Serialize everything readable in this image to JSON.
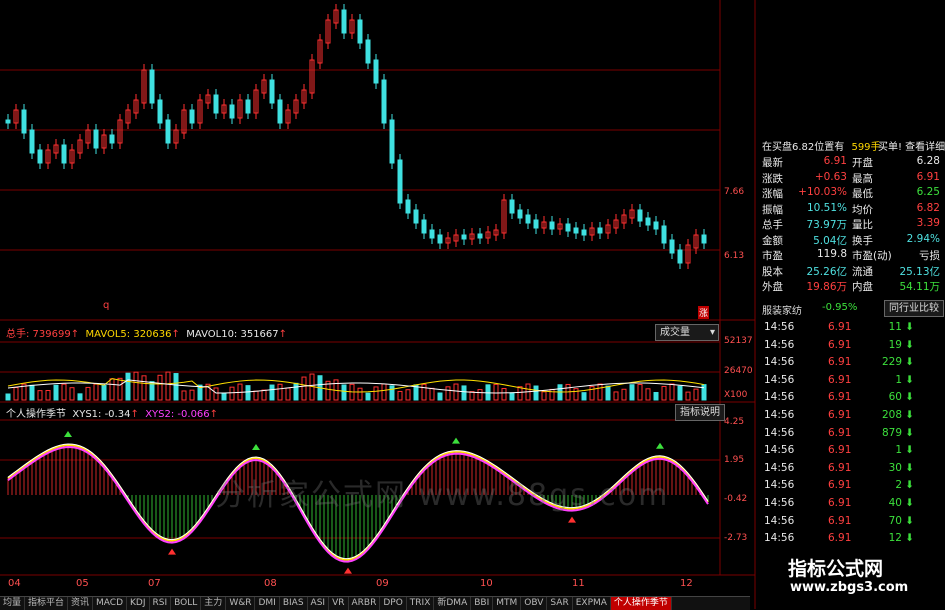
{
  "price_axis": {
    "ticks": [
      "7.66",
      "6.13"
    ]
  },
  "marker_labels": {
    "left_top": "q",
    "right_mark": "涨"
  },
  "volume_header": {
    "total": "总手: 739699",
    "mavol5": "MAVOL5: 320636",
    "mavol10": "MAVOL10: 351667"
  },
  "volume_axis": {
    "ticks": [
      "52137",
      "26470",
      "X100"
    ]
  },
  "volume_button": "成交量",
  "indicator_header": {
    "name": "个人操作季节",
    "xys1": "XYS1: -0.34",
    "xys2": "XYS2: -0.066"
  },
  "indicator_button": "指标说明",
  "indicator_axis": {
    "ticks": [
      "4.25",
      "1.95",
      "-0.42",
      "-2.73"
    ]
  },
  "date_axis": [
    "04",
    "05",
    "07",
    "08",
    "09",
    "10",
    "11",
    "12"
  ],
  "tabs": [
    "均量",
    "指标平台",
    "资讯",
    "MACD",
    "KDJ",
    "RSI",
    "BOLL",
    "主力",
    "W&R",
    "DMI",
    "BIAS",
    "ASI",
    "VR",
    "ARBR",
    "DPO",
    "TRIX",
    "新DMA",
    "BBI",
    "MTM",
    "OBV",
    "SAR",
    "EXPMA",
    "个人操作季节"
  ],
  "active_tab": "个人操作季节",
  "order_header": {
    "text": "在买盘6.82位置有",
    "qty": "599手",
    "link": "买单! 查看详细"
  },
  "quote": [
    {
      "l1": "最新",
      "v1": "6.91",
      "c1": "red",
      "l2": "开盘",
      "v2": "6.28",
      "c2": "white"
    },
    {
      "l1": "涨跌",
      "v1": "+0.63",
      "c1": "red",
      "l2": "最高",
      "v2": "6.91",
      "c2": "red"
    },
    {
      "l1": "涨幅",
      "v1": "+10.03%",
      "c1": "red",
      "l2": "最低",
      "v2": "6.25",
      "c2": "green"
    },
    {
      "l1": "振幅",
      "v1": "10.51%",
      "c1": "cyan",
      "l2": "均价",
      "v2": "6.82",
      "c2": "red"
    },
    {
      "l1": "总手",
      "v1": "73.97万",
      "c1": "cyan",
      "l2": "量比",
      "v2": "3.39",
      "c2": "red"
    },
    {
      "l1": "金额",
      "v1": "5.04亿",
      "c1": "cyan",
      "l2": "换手",
      "v2": "2.94%",
      "c2": "cyan"
    },
    {
      "l1": "市盈",
      "v1": "119.8",
      "c1": "white",
      "l2": "市盈(动)",
      "v2": "亏损",
      "c2": "white"
    },
    {
      "l1": "股本",
      "v1": "25.26亿",
      "c1": "cyan",
      "l2": "流通",
      "v2": "25.13亿",
      "c2": "cyan"
    },
    {
      "l1": "外盘",
      "v1": "19.86万",
      "c1": "red",
      "l2": "内盘",
      "v2": "54.11万",
      "c2": "green"
    }
  ],
  "sector": {
    "name": "服装家纺",
    "change": "-0.95%",
    "button": "同行业比较"
  },
  "trades": [
    {
      "time": "14:56",
      "price": "6.91",
      "qty": "11",
      "dir": "down"
    },
    {
      "time": "14:56",
      "price": "6.91",
      "qty": "19",
      "dir": "down"
    },
    {
      "time": "14:56",
      "price": "6.91",
      "qty": "229",
      "dir": "down"
    },
    {
      "time": "14:56",
      "price": "6.91",
      "qty": "1",
      "dir": "down"
    },
    {
      "time": "14:56",
      "price": "6.91",
      "qty": "60",
      "dir": "down"
    },
    {
      "time": "14:56",
      "price": "6.91",
      "qty": "208",
      "dir": "down"
    },
    {
      "time": "14:56",
      "price": "6.91",
      "qty": "879",
      "dir": "down"
    },
    {
      "time": "14:56",
      "price": "6.91",
      "qty": "1",
      "dir": "down"
    },
    {
      "time": "14:56",
      "price": "6.91",
      "qty": "30",
      "dir": "down"
    },
    {
      "time": "14:56",
      "price": "6.91",
      "qty": "2",
      "dir": "down"
    },
    {
      "time": "14:56",
      "price": "6.91",
      "qty": "40",
      "dir": "down"
    },
    {
      "time": "14:56",
      "price": "6.91",
      "qty": "70",
      "dir": "down"
    },
    {
      "time": "14:56",
      "price": "6.91",
      "qty": "12",
      "dir": "down"
    }
  ],
  "watermark": "分析家公式网 www.88gs.com",
  "brand": {
    "title": "指标公式网",
    "url": "www.zbgs3.com"
  },
  "colors": {
    "up": "#ff3030",
    "down": "#3fe0e0",
    "grid": "#8b0000",
    "line1": "#ffffff",
    "line2": "#ff40ff",
    "line3": "#ffe000"
  }
}
